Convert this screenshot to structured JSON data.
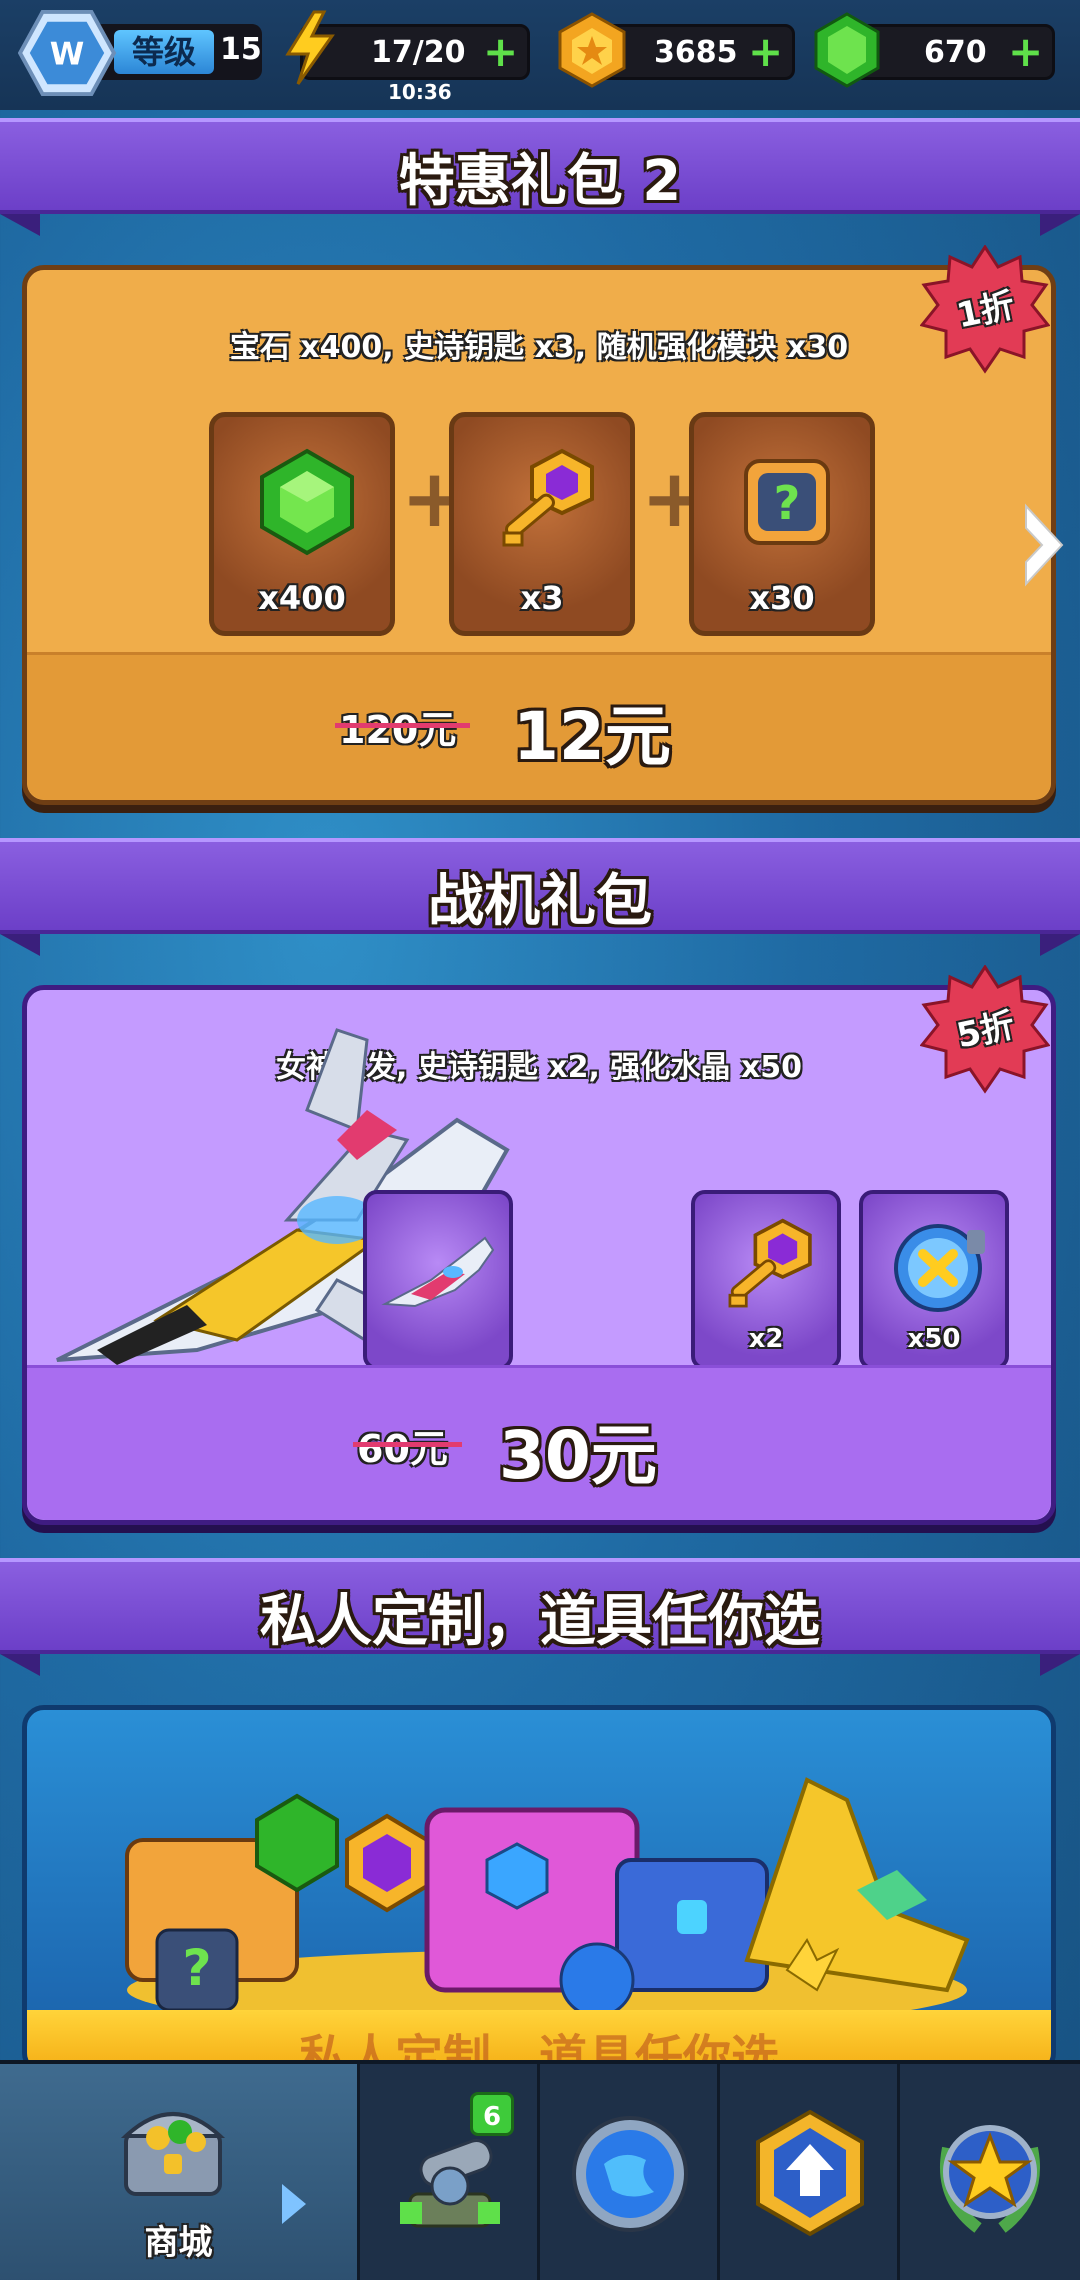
{
  "topbar": {
    "level_label": "等级",
    "level_value": "15",
    "energy": "17/20",
    "energy_timer": "10:36",
    "coins": "3685",
    "gems": "670"
  },
  "sections": [
    {
      "title": "特惠礼包 2",
      "description": "宝石 x400, 史诗钥匙 x3, 随机强化模块 x30",
      "discount": "1折",
      "items": [
        {
          "icon": "green-gem-icon",
          "qty": "x400"
        },
        {
          "icon": "epic-key-icon",
          "qty": "x3"
        },
        {
          "icon": "random-module-chip-icon",
          "qty": "x30"
        }
      ],
      "old_price": "120元",
      "new_price": "12元"
    },
    {
      "title": "战机礼包",
      "description": "女神银发, 史诗钥匙 x2, 强化水晶 x50",
      "discount": "5折",
      "items": [
        {
          "icon": "fighter-jet-icon",
          "qty": ""
        },
        {
          "icon": "epic-key-icon",
          "qty": "x2"
        },
        {
          "icon": "upgrade-crystal-orb-icon",
          "qty": "x50"
        }
      ],
      "old_price": "60元",
      "new_price": "30元"
    },
    {
      "title": "私人定制，道具任你选",
      "banner_text": "私人定制，道具任你选"
    }
  ],
  "bottom_nav": {
    "tabs": [
      {
        "icon": "treasure-chest-icon",
        "label": "商城"
      },
      {
        "icon": "cannon-upgrade-icon",
        "label": "",
        "badge": "6"
      },
      {
        "icon": "radar-globe-icon",
        "label": ""
      },
      {
        "icon": "upgrade-arrow-shield-icon",
        "label": ""
      },
      {
        "icon": "star-laurel-icon",
        "label": ""
      }
    ]
  },
  "colors": {
    "section_banner": "#7a4fd4",
    "orange_card": "#f0ad4a",
    "purple_card": "#c49bff",
    "discount_badge": "#e23b55",
    "price_strike": "#e23b6f",
    "plus_green": "#5fe04a"
  }
}
